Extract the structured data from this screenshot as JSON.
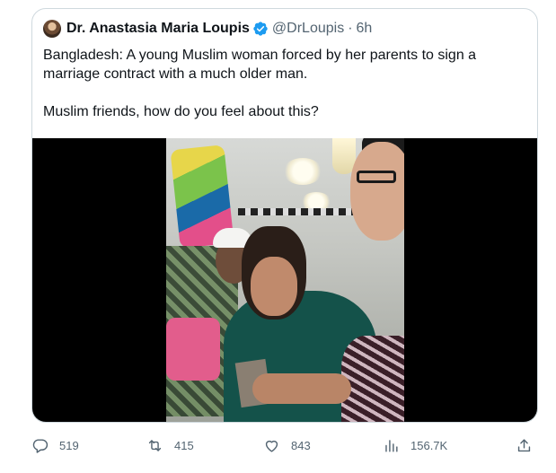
{
  "quoted_tweet": {
    "author_name": "Dr. Anastasia Maria Loupis",
    "handle": "@DrLoupis",
    "separator": "·",
    "time": "6h",
    "text_line1": "Bangladesh: A young Muslim woman forced by her parents to sign a marriage contract with a much older man.",
    "text_line2": "Muslim friends, how do you feel about this?",
    "verified_color": "#1d9bf0"
  },
  "actions": {
    "replies": "519",
    "retweets": "415",
    "likes": "843",
    "views": "156.7K"
  },
  "icons": [
    "reply-icon",
    "retweet-icon",
    "like-icon",
    "views-icon",
    "share-icon",
    "verified-badge-icon"
  ]
}
